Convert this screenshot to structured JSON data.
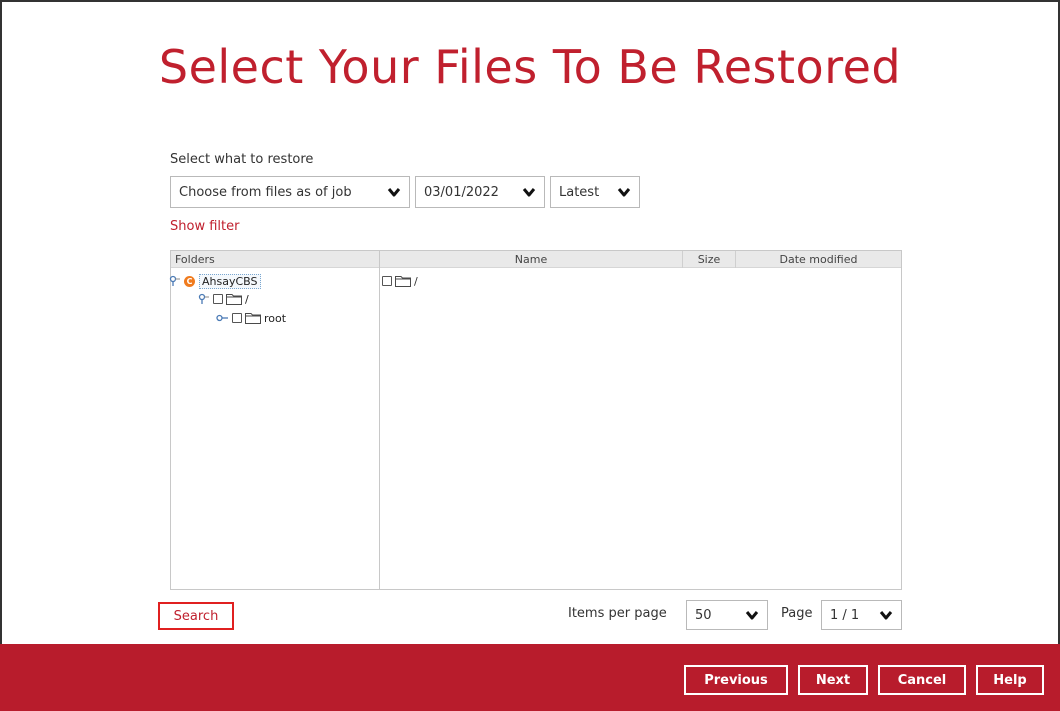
{
  "page_title": "Select Your Files To Be Restored",
  "restore": {
    "label": "Select what to restore",
    "mode_value": "Choose from files as of job",
    "date_value": "03/01/2022",
    "version_value": "Latest"
  },
  "show_filter": "Show filter",
  "folders_panel": {
    "header": "Folders",
    "tree": {
      "root_label": "AhsayCBS",
      "root_icon": "ahsaycbs-icon",
      "children": [
        {
          "label": "/",
          "children": [
            {
              "label": "root"
            }
          ]
        }
      ]
    }
  },
  "files_panel": {
    "columns": {
      "name": "Name",
      "size": "Size",
      "date": "Date modified"
    },
    "rows": [
      {
        "name": "/",
        "size": "",
        "date": ""
      }
    ]
  },
  "search_label": "Search",
  "pagination": {
    "items_per_page_label": "Items per page",
    "items_per_page_value": "50",
    "page_label": "Page",
    "page_value": "1 / 1"
  },
  "footer": {
    "previous": "Previous",
    "next": "Next",
    "cancel": "Cancel",
    "help": "Help"
  },
  "colors": {
    "accent": "#c0202e",
    "footer_bg": "#b81c2c",
    "search_border": "#e02020"
  }
}
